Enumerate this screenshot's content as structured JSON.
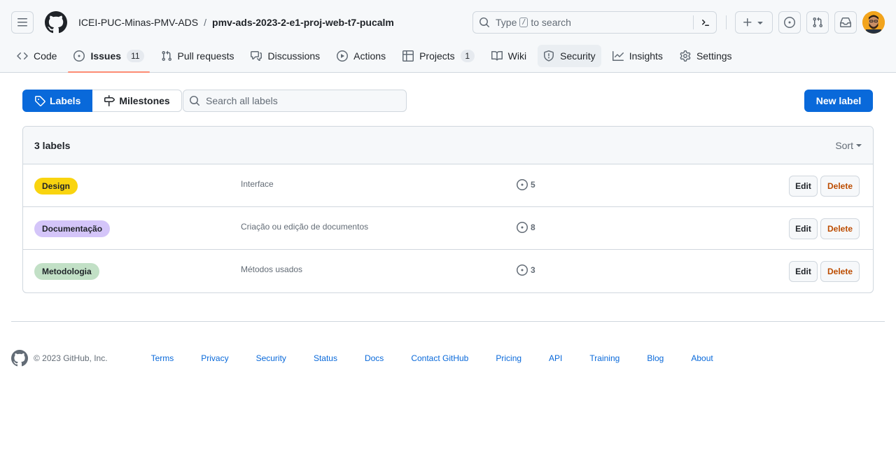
{
  "header": {
    "owner": "ICEI-PUC-Minas-PMV-ADS",
    "separator": "/",
    "repo": "pmv-ads-2023-2-e1-proj-web-t7-pucalm",
    "search": {
      "type_text": "Type",
      "key": "/",
      "suffix": "to search"
    }
  },
  "tabs": [
    {
      "label": "Code",
      "icon": "code-icon"
    },
    {
      "label": "Issues",
      "icon": "issue-opened-icon",
      "counter": "11",
      "active": true
    },
    {
      "label": "Pull requests",
      "icon": "git-pull-request-icon"
    },
    {
      "label": "Discussions",
      "icon": "comment-discussion-icon"
    },
    {
      "label": "Actions",
      "icon": "play-icon"
    },
    {
      "label": "Projects",
      "icon": "table-icon",
      "counter": "1"
    },
    {
      "label": "Wiki",
      "icon": "book-icon"
    },
    {
      "label": "Security",
      "icon": "shield-icon"
    },
    {
      "label": "Insights",
      "icon": "graph-icon"
    },
    {
      "label": "Settings",
      "icon": "gear-icon"
    }
  ],
  "subnav": {
    "labels": "Labels",
    "milestones": "Milestones",
    "search_placeholder": "Search all labels",
    "new_label": "New label"
  },
  "labels_box": {
    "count": "3 labels",
    "sort": "Sort",
    "rows": [
      {
        "name": "Design",
        "color": "#f9d40f",
        "description": "Interface",
        "issues": "5",
        "edit": "Edit",
        "delete": "Delete"
      },
      {
        "name": "Documentação",
        "color": "#d4c5f9",
        "description": "Criação ou edição de documentos",
        "issues": "8",
        "edit": "Edit",
        "delete": "Delete"
      },
      {
        "name": "Metodologia",
        "color": "#c2e0c6",
        "description": "Métodos usados",
        "issues": "3",
        "edit": "Edit",
        "delete": "Delete"
      }
    ]
  },
  "footer": {
    "copyright": "© 2023 GitHub, Inc.",
    "links": [
      "Terms",
      "Privacy",
      "Security",
      "Status",
      "Docs",
      "Contact GitHub",
      "Pricing",
      "API",
      "Training",
      "Blog",
      "About"
    ]
  },
  "colors": {
    "accent": "#0969da",
    "active_tab_underline": "#fd8c73",
    "danger_text": "#bc4c00"
  }
}
